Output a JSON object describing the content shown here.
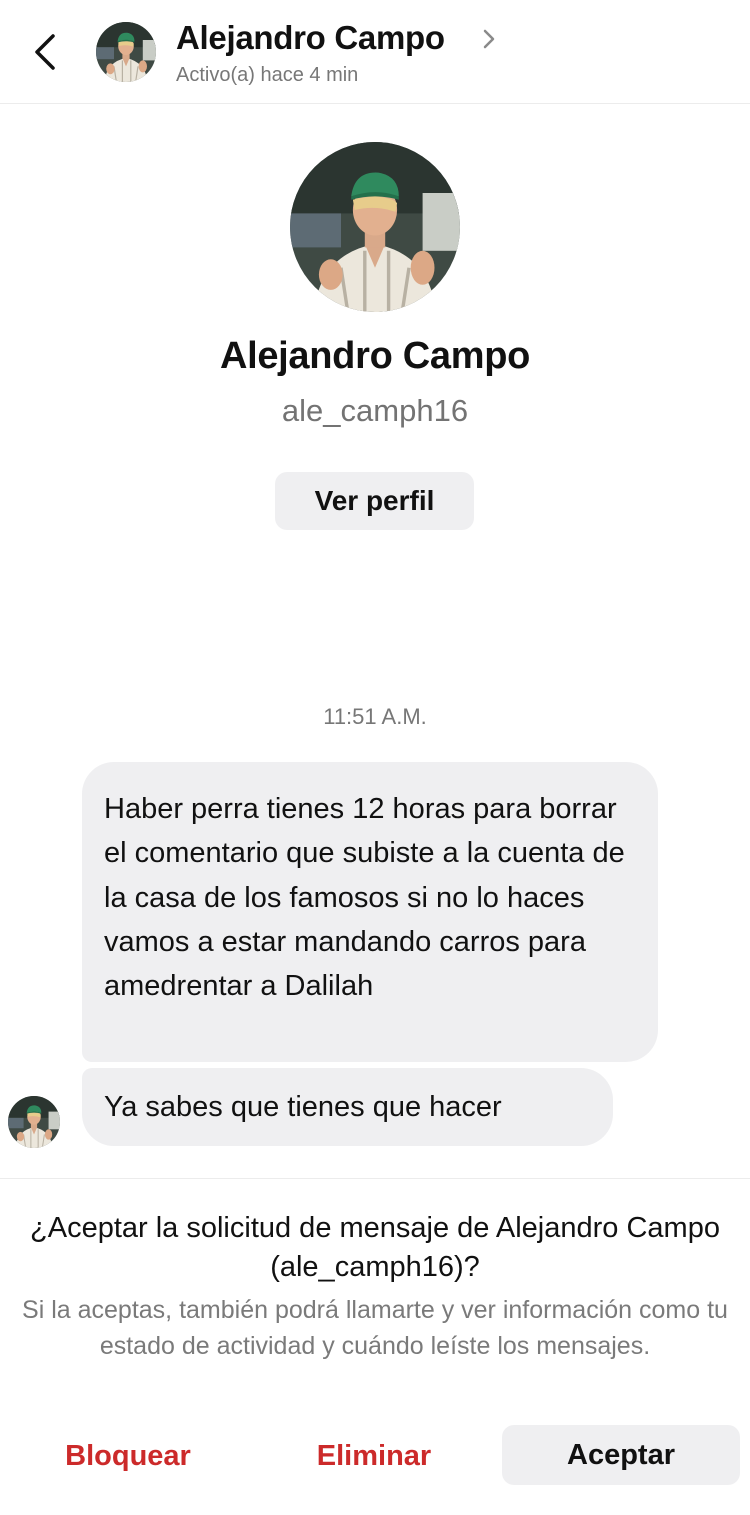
{
  "header": {
    "contact_name": "Alejandro Campo",
    "status": "Activo(a) hace 4 min",
    "back_icon": "chevron-left-icon",
    "forward_icon": "chevron-right-icon"
  },
  "profile": {
    "name": "Alejandro Campo",
    "username": "ale_camph16",
    "view_profile_label": "Ver perfil"
  },
  "conversation": {
    "timestamp": "11:51 A.M.",
    "messages": [
      {
        "text": "Haber perra tienes 12 horas para borrar el comentario que subiste a la cuenta de la casa de los famosos si no lo haces vamos a estar mandando carros para amedrentar a Dalilah"
      },
      {
        "text": "Ya sabes que tienes que hacer"
      }
    ]
  },
  "request": {
    "title": "¿Aceptar la solicitud de mensaje de Alejandro Campo (ale_camph16)?",
    "description": "Si la aceptas, también podrá llamarte y ver información como tu estado de actividad y cuándo leíste los mensajes.",
    "block_label": "Bloquear",
    "delete_label": "Eliminar",
    "accept_label": "Aceptar"
  },
  "colors": {
    "destructive": "#cc2a2a",
    "bubble_bg": "#efeff1",
    "secondary_text": "#737373"
  }
}
